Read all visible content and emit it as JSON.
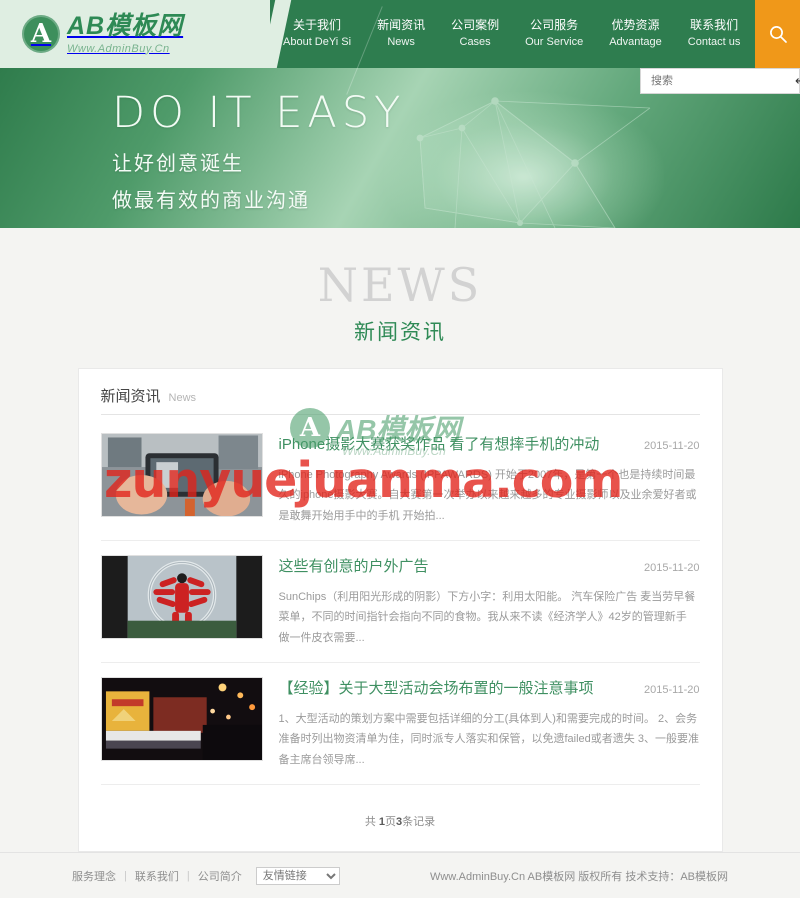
{
  "site": {
    "logo_letter": "A",
    "logo_name": "AB模板网",
    "logo_url": "Www.AdminBuy.Cn"
  },
  "nav": {
    "items": [
      {
        "cn": "关于我们",
        "en": "About DeYi Si"
      },
      {
        "cn": "新闻资讯",
        "en": "News"
      },
      {
        "cn": "公司案例",
        "en": "Cases"
      },
      {
        "cn": "公司服务",
        "en": "Our Service"
      },
      {
        "cn": "优势资源",
        "en": "Advantage"
      },
      {
        "cn": "联系我们",
        "en": "Contact us"
      }
    ],
    "search_icon": "search-icon",
    "search_placeholder": "搜索",
    "search_value": "",
    "search_enter_glyph": "↵"
  },
  "banner": {
    "title": "DO IT EASY",
    "line1": "让好创意诞生",
    "line2": "做最有效的商业沟通"
  },
  "section": {
    "title_en": "NEWS",
    "title_cn": "新闻资讯"
  },
  "panel": {
    "title_cn": "新闻资讯",
    "title_en": "News"
  },
  "news": [
    {
      "title": "iPhone摄影大赛获奖作品 看了有想摔手机的冲动",
      "date": "2015-11-20",
      "desc": "iPhone Photography Awards (IPPAWARDS) 开始于2007年，是第一个也是持续时间最久的iphone摄影大赛。自大赛第一次举办以来越来越多的专业摄影师以及业余爱好者或是敢舞开始用手中的手机 开始拍..."
    },
    {
      "title": "这些有创意的户外广告",
      "date": "2015-11-20",
      "desc": "SunChips（利用阳光形成的阴影）下方小字：利用太阳能。 汽车保险广告 麦当劳早餐菜单，不同的时间指针会指向不同的食物。我从来不读《经济学人》42岁的管理新手 做一件皮衣需要..."
    },
    {
      "title": "【经验】关于大型活动会场布置的一般注意事项",
      "date": "2015-11-20",
      "desc": "1、大型活动的策划方案中需要包括详细的分工(具体到人)和需要完成的时间。 2、会务准备时列出物资清单为佳，同时派专人落实和保管，以免遗failed或者遗失 3、一般要准备主席台领导席..."
    }
  ],
  "pager": {
    "prefix": "共",
    "pages": "1",
    "mid": "页",
    "count": "3",
    "suffix": "条记录"
  },
  "footer": {
    "links": [
      "服务理念",
      "联系我们",
      "公司简介"
    ],
    "divider": "|",
    "select_label": "友情链接",
    "copyright": "Www.AdminBuy.Cn AB模板网 版权所有   技术支持：AB模板网"
  },
  "watermark": {
    "red": "zunyuejuanma.com",
    "green_badge": "A",
    "green_name": "AB模板网",
    "green_url": "Www.AdminBuy.Cn"
  }
}
